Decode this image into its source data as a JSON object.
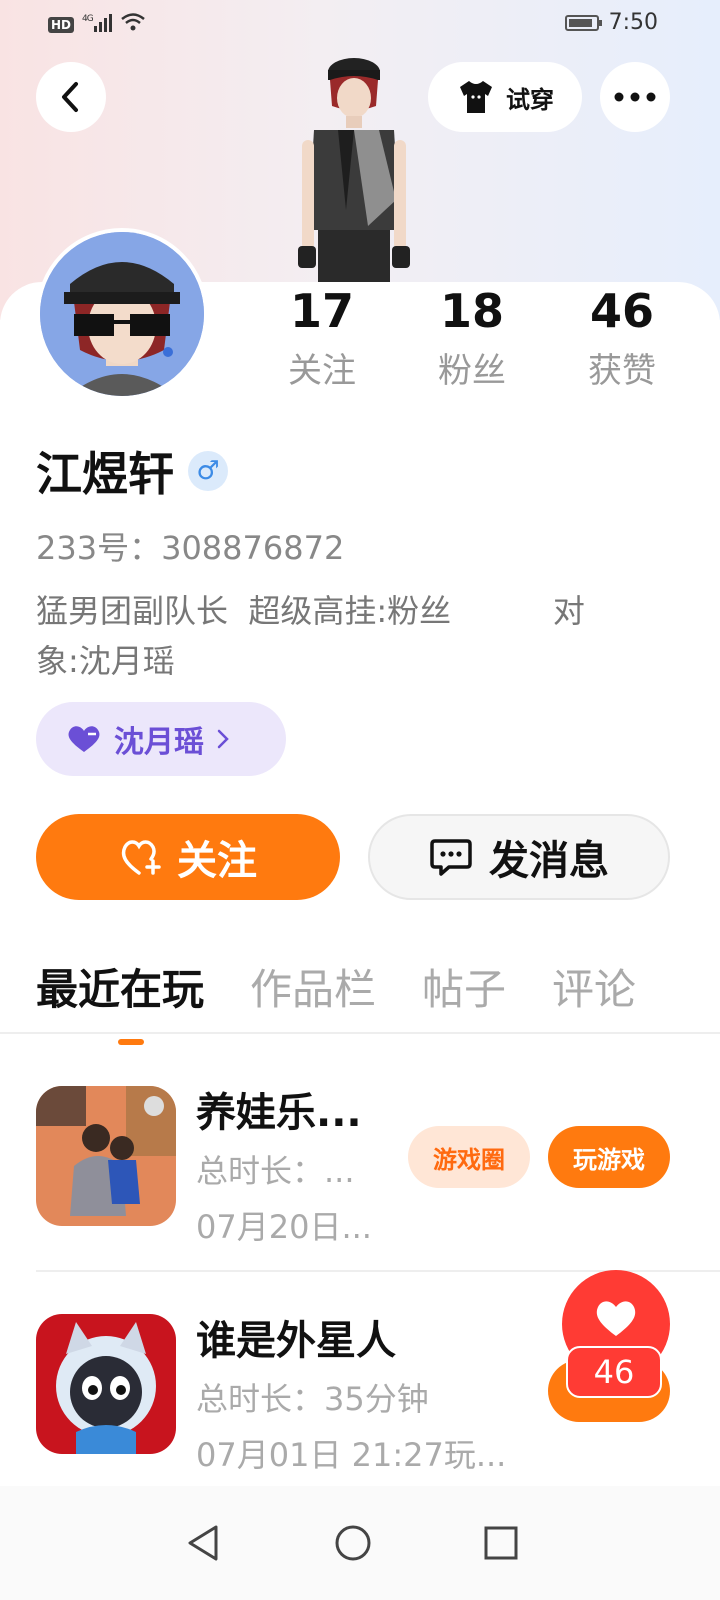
{
  "status_bar": {
    "hd": "HD",
    "network": "4G",
    "time": "7:50",
    "battery_level": 0.9
  },
  "header": {
    "tryon_label": "试穿"
  },
  "stats": [
    {
      "count": "17",
      "label": "关注"
    },
    {
      "count": "18",
      "label": "粉丝"
    },
    {
      "count": "46",
      "label": "获赞"
    }
  ],
  "profile": {
    "name": "江煜轩",
    "gender_symbol": "♂",
    "uid": "233号：308876872",
    "bio_line1": "猛男团副队长  超级高挂:粉丝          对",
    "bio_line2": "象:沈月瑶",
    "cp_tag": "沈月瑶"
  },
  "actions": {
    "follow_label": "关注",
    "message_label": "发消息"
  },
  "tabs": [
    "最近在玩",
    "作品栏",
    "帖子",
    "评论"
  ],
  "games": [
    {
      "title": "养娃乐...",
      "duration": "总时长：...",
      "last_played": "07月20日...",
      "circle_button": "游戏圈",
      "play_button": "玩游戏"
    },
    {
      "title": "谁是外星人",
      "duration": "总时长：35分钟",
      "last_played": "07月01日 21:27玩..."
    }
  ],
  "like_fab": {
    "count": "46"
  },
  "colors": {
    "accent": "#ff7a0f",
    "like_red": "#ff3b34",
    "cp_purple": "#6b4fd6"
  }
}
